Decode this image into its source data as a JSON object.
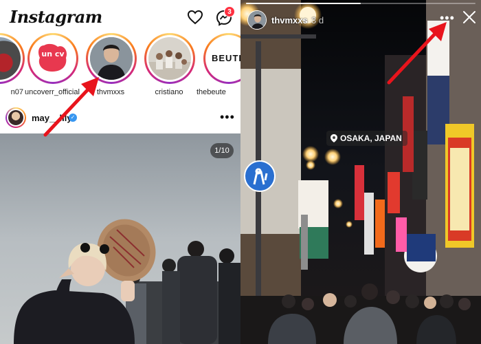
{
  "feed": {
    "logo": "Instagram",
    "notifications_badge": "3",
    "stories": [
      {
        "username": "n07"
      },
      {
        "username": "uncoverr_official"
      },
      {
        "username": "thvmxxs"
      },
      {
        "username": "cristiano"
      },
      {
        "username": "thebeute"
      }
    ],
    "uncoverr_logo_text": "un cv",
    "beute_logo_text": "BEUTE",
    "post": {
      "username": "may__lily",
      "verified": true,
      "more_icon": "more-horizontal-icon",
      "media_counter": "1/10"
    }
  },
  "story_viewer": {
    "username": "thvmxxs",
    "time_ago": "3 d",
    "location_sticker": "OSAKA, JAPAN",
    "progress": 0.5
  },
  "colors": {
    "story_ring": [
      "#feda75",
      "#fa7e1e",
      "#d62976",
      "#962fbf"
    ],
    "badge": "#ff3040",
    "verified": "#3897f0",
    "arrow": "#e8141c"
  }
}
